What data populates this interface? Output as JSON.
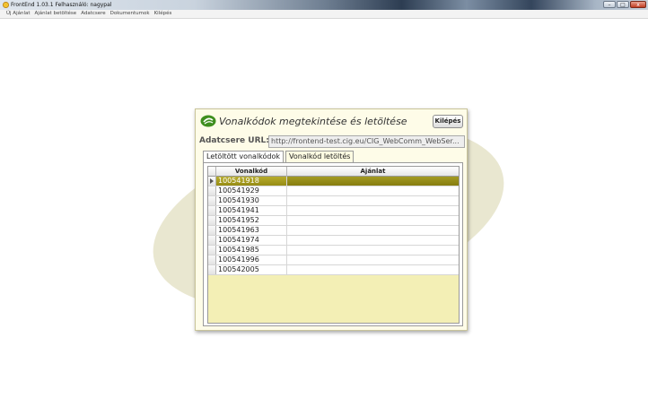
{
  "window": {
    "title": "FrontEnd 1.03.1  Felhasználó: nagypal",
    "buttons": {
      "minimize": "–",
      "maximize": "□",
      "close": "x"
    }
  },
  "menu": {
    "items": [
      "Új Ajánlat",
      "Ajánlat betöltése",
      "Adatcsere",
      "Dokumentumok",
      "Kilépés"
    ]
  },
  "dialog": {
    "title": "Vonalkódok megtekintése és letöltése",
    "exit_label": "Kilépés",
    "url_label": "Adatcsere URL:",
    "url_value": "http://frontend-test.cig.eu/CIG_WebComm_WebSer...",
    "tabs": [
      {
        "label": "Letöltött vonalkódok",
        "active": true
      },
      {
        "label": "Vonalkód letöltés",
        "active": false
      }
    ],
    "grid": {
      "columns": [
        "Vonalkód",
        "Ajánlat"
      ],
      "rows": [
        {
          "barcode": "100541918",
          "offer": "",
          "selected": true
        },
        {
          "barcode": "100541929",
          "offer": ""
        },
        {
          "barcode": "100541930",
          "offer": ""
        },
        {
          "barcode": "100541941",
          "offer": ""
        },
        {
          "barcode": "100541952",
          "offer": ""
        },
        {
          "barcode": "100541963",
          "offer": ""
        },
        {
          "barcode": "100541974",
          "offer": ""
        },
        {
          "barcode": "100541985",
          "offer": ""
        },
        {
          "barcode": "100541996",
          "offer": ""
        },
        {
          "barcode": "100542005",
          "offer": ""
        }
      ]
    }
  },
  "colors": {
    "dialog_bg": "#fefce8",
    "selected_row": "#a39a22",
    "grid_bg": "#f3efb5",
    "logo": "#3f8f1f"
  }
}
